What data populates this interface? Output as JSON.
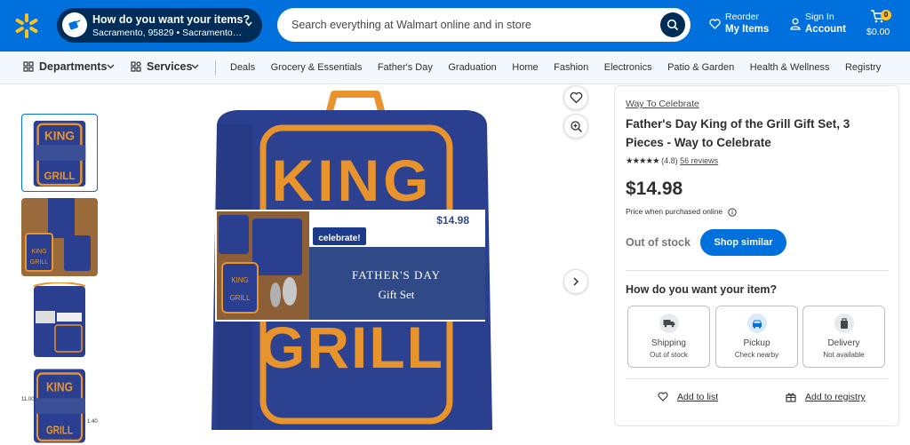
{
  "header": {
    "location_title": "How do you want your items?",
    "location_detail": "Sacramento, 95829 • Sacramento Su...",
    "search_placeholder": "Search everything at Walmart online and in store",
    "reorder_line1": "Reorder",
    "reorder_line2": "My Items",
    "signin_line1": "Sign In",
    "signin_line2": "Account",
    "cart_count": "0",
    "cart_total": "$0.00"
  },
  "nav": {
    "departments": "Departments",
    "services": "Services",
    "links": [
      "Deals",
      "Grocery & Essentials",
      "Father's Day",
      "Graduation",
      "Home",
      "Fashion",
      "Electronics",
      "Patio & Garden",
      "Health & Wellness",
      "Registry"
    ]
  },
  "gallery": {
    "band_price": "$14.98",
    "band_brand": "celebrate!",
    "band_title_1": "FATHER'S DAY",
    "band_title_2": "Gift Set",
    "king": "KING",
    "grill": "GRILL",
    "thumb_dim_1": "11.00\"",
    "thumb_dim_2": "1.40"
  },
  "product": {
    "brand": "Way To Celebrate",
    "title": "Father's Day King of the Grill Gift Set, 3 Pieces - Way to Celebrate",
    "stars": "★★★★★",
    "rating": "(4.8)",
    "reviews": "56 reviews",
    "price": "$14.98",
    "price_note": "Price when purchased online",
    "stock_status": "Out of stock",
    "shop_similar": "Shop similar",
    "fulfillment_heading": "How do you want your item?",
    "options": [
      {
        "label": "Shipping",
        "status": "Out of stock"
      },
      {
        "label": "Pickup",
        "status": "Check nearby"
      },
      {
        "label": "Delivery",
        "status": "Not available"
      }
    ],
    "add_to_list": "Add to list",
    "add_to_registry": "Add to registry"
  },
  "colors": {
    "brand_blue": "#0071dc",
    "dark_blue": "#002d58",
    "spark_yellow": "#ffc220",
    "apron_navy": "#2a3f8f",
    "trim_orange": "#e8932c"
  }
}
